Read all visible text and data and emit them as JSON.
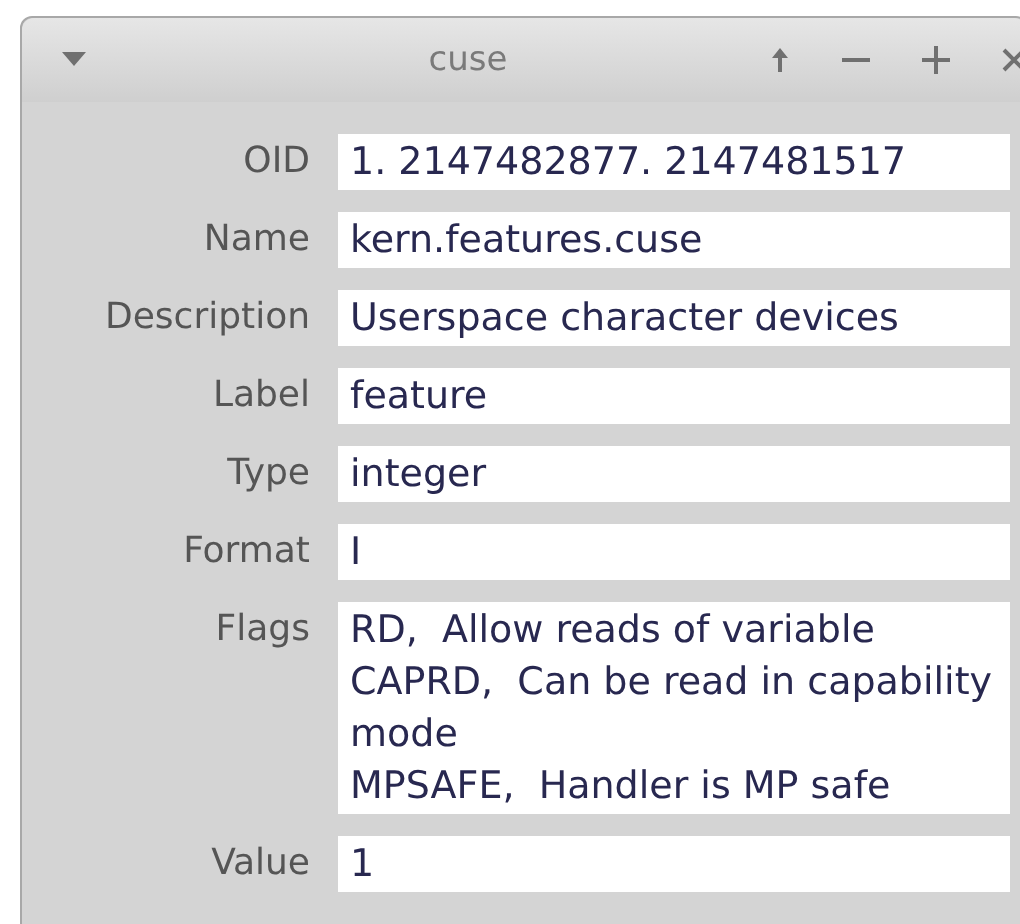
{
  "window": {
    "title": "cuse"
  },
  "fields": [
    {
      "label": "OID",
      "value": "1. 2147482877. 2147481517"
    },
    {
      "label": "Name",
      "value": "kern.features.cuse"
    },
    {
      "label": "Description",
      "value": "Userspace character devices"
    },
    {
      "label": "Label",
      "value": "feature"
    },
    {
      "label": "Type",
      "value": "integer"
    },
    {
      "label": "Format",
      "value": "I"
    },
    {
      "label": "Flags",
      "lines": [
        "RD,  Allow reads of variable",
        "CAPRD,  Can be read in capability mode",
        "MPSAFE,  Handler is MP safe"
      ]
    },
    {
      "label": "Value",
      "value": "1"
    }
  ]
}
